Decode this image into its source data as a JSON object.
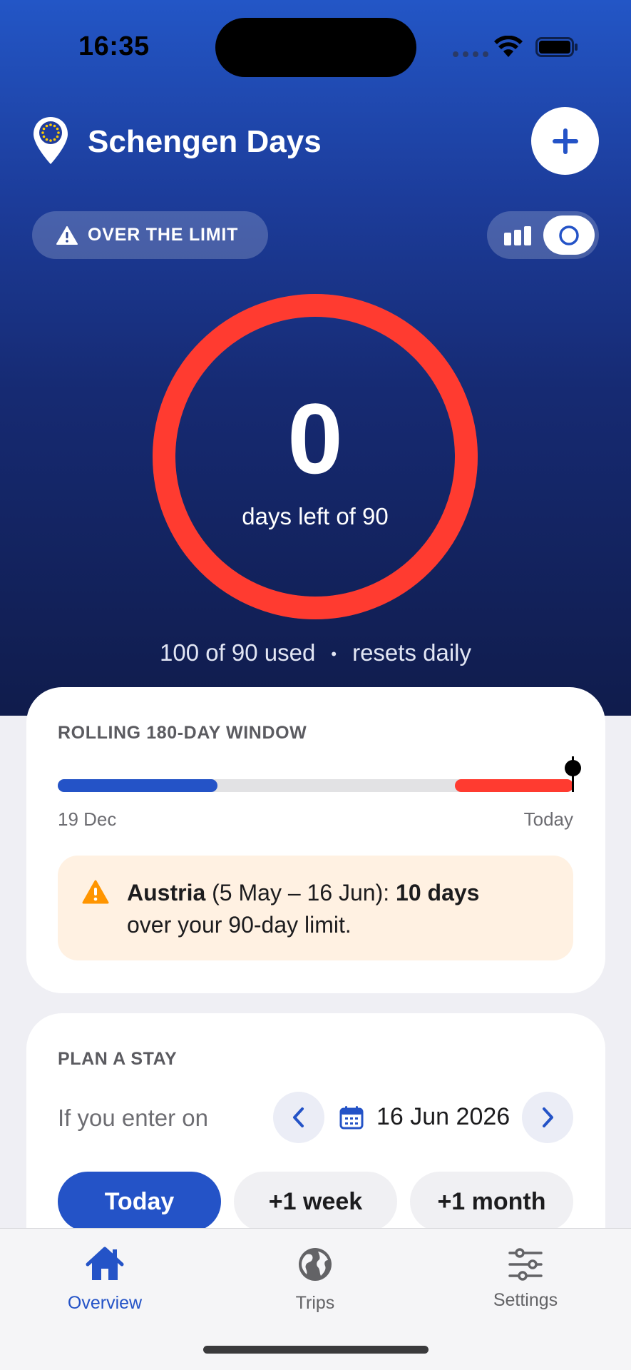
{
  "status_bar": {
    "time": "16:35"
  },
  "header": {
    "title": "Schengen Days",
    "add_icon": "plus-icon",
    "pin_icon": "eu-location-pin-icon"
  },
  "status_pill": {
    "label": "OVER THE LIMIT",
    "icon": "warning-triangle-icon"
  },
  "view_toggle": {
    "left_icon": "bar-chart-icon",
    "right_icon": "ring-icon",
    "selected": "ring"
  },
  "summary": {
    "days_left": "0",
    "caption": "days left of 90",
    "used_text": "100 of 90 used",
    "separator": "•",
    "reset_text": "resets daily",
    "ring_color": "#ff3b30",
    "ring_progress": 1.0
  },
  "window_card": {
    "title": "ROLLING 180-DAY WINDOW",
    "start_label": "19 Dec",
    "end_label": "Today",
    "segments": [
      {
        "start": 0.0,
        "end": 0.31,
        "color": "#2453c7"
      },
      {
        "start": 0.77,
        "end": 1.0,
        "color": "#ff3b30"
      }
    ],
    "warning": {
      "country": "Austria",
      "range": "(5 May – 16 Jun):",
      "amount": "10 days",
      "rest": "over your 90-day limit.",
      "icon": "warning-triangle-icon"
    }
  },
  "plan_card": {
    "title": "PLAN A STAY",
    "prompt": "If you enter on",
    "date": "16 Jun 2026",
    "prev_icon": "chevron-left-icon",
    "next_icon": "chevron-right-icon",
    "calendar_icon": "calendar-icon",
    "chips": [
      {
        "label": "Today",
        "active": true
      },
      {
        "label": "+1 week",
        "active": false
      },
      {
        "label": "+1 month",
        "active": false
      }
    ]
  },
  "tabs": [
    {
      "label": "Overview",
      "icon": "house-icon",
      "active": true
    },
    {
      "label": "Trips",
      "icon": "globe-icon",
      "active": false
    },
    {
      "label": "Settings",
      "icon": "sliders-icon",
      "active": false
    }
  ],
  "colors": {
    "accent": "#2453c7",
    "danger": "#ff3b30",
    "warning": "#ff9500"
  }
}
